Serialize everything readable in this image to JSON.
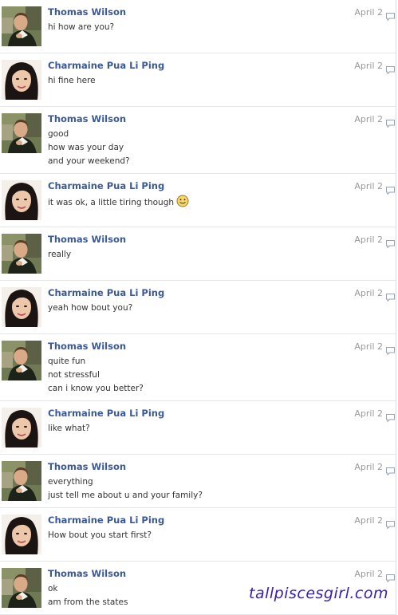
{
  "messages": [
    {
      "sender": "Thomas Wilson",
      "date": "April 2",
      "avatar": "male",
      "lines": [
        "hi how are you?"
      ]
    },
    {
      "sender": "Charmaine Pua Li Ping",
      "date": "April 2",
      "avatar": "female",
      "lines": [
        "hi fine here"
      ]
    },
    {
      "sender": "Thomas Wilson",
      "date": "April 2",
      "avatar": "male",
      "lines": [
        "good",
        "how was your day",
        "and your weekend?"
      ]
    },
    {
      "sender": "Charmaine Pua Li Ping",
      "date": "April 2",
      "avatar": "female",
      "lines": [
        "it was ok, a little tiring though"
      ],
      "emoji": "smiley-icon"
    },
    {
      "sender": "Thomas Wilson",
      "date": "April 2",
      "avatar": "male",
      "lines": [
        "really"
      ]
    },
    {
      "sender": "Charmaine Pua Li Ping",
      "date": "April 2",
      "avatar": "female",
      "lines": [
        "yeah how bout you?"
      ]
    },
    {
      "sender": "Thomas Wilson",
      "date": "April 2",
      "avatar": "male",
      "lines": [
        "quite fun",
        "not stressful",
        "can i know you better?"
      ]
    },
    {
      "sender": "Charmaine Pua Li Ping",
      "date": "April 2",
      "avatar": "female",
      "lines": [
        "like what?"
      ]
    },
    {
      "sender": "Thomas Wilson",
      "date": "April 2",
      "avatar": "male",
      "lines": [
        "everything",
        "just tell me about u and your family?"
      ]
    },
    {
      "sender": "Charmaine Pua Li Ping",
      "date": "April 2",
      "avatar": "female",
      "lines": [
        "How bout you start first?"
      ]
    },
    {
      "sender": "Thomas Wilson",
      "date": "April 2",
      "avatar": "male",
      "lines": [
        "ok",
        "am from the states"
      ]
    }
  ],
  "watermark": "tallpiscesgirl.com",
  "colors": {
    "name": "#3b5998",
    "text": "#333333",
    "date": "#999999",
    "divider": "#e3e6ee",
    "watermark": "#3b1fa8"
  }
}
